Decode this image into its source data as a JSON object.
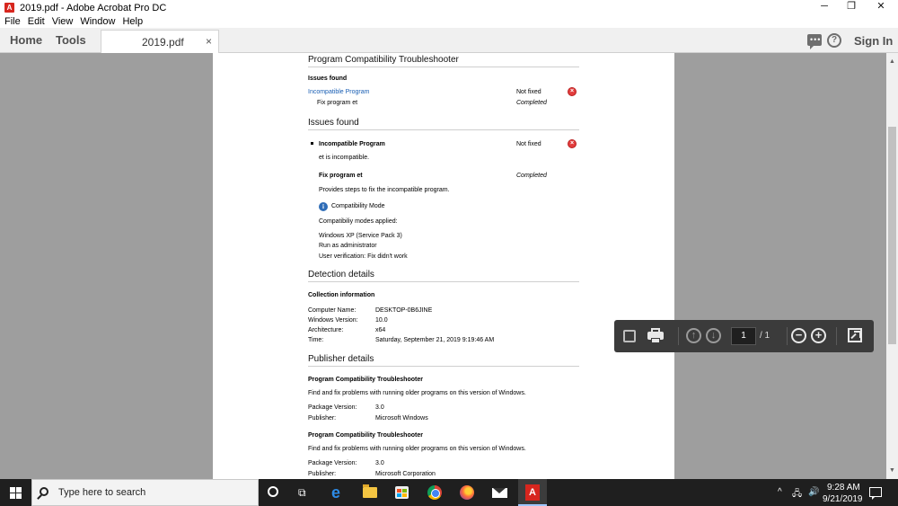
{
  "window": {
    "title": "2019.pdf - Adobe Acrobat Pro DC",
    "app_icon": "acrobat-pdf-icon",
    "minimize": "─",
    "maximize": "❐",
    "close": "✕"
  },
  "menu": [
    "File",
    "Edit",
    "View",
    "Window",
    "Help"
  ],
  "tabs": {
    "home": "Home",
    "tools": "Tools",
    "document": "2019.pdf",
    "document_close": "×",
    "sign_in": "Sign In",
    "help_glyph": "?"
  },
  "document": {
    "section1_title": "Program Compatibility Troubleshooter",
    "issues_found_small": "Issues found",
    "issue_link": "Incompatible Program",
    "issue_status": "Not fixed",
    "fix_label": "Fix program et",
    "fix_status": "Completed",
    "section2_title": "Issues found",
    "issue_bold": "Incompatible Program",
    "issue_bold_status": "Not fixed",
    "issue_desc": "et is incompatible.",
    "fix_bold": "Fix program et",
    "fix_bold_status": "Completed",
    "fix_desc": "Provides steps to fix the incompatible program.",
    "compat_mode": "Compatibility Mode",
    "compat_applied": "Compatibiliy modes applied:",
    "mode_1": "Windows XP (Service Pack 3)",
    "mode_2": "Run as administrator",
    "mode_3": "User verification: Fix didn't work",
    "detection_title": "Detection details",
    "collection_title": "Collection information",
    "computer_name_label": "Computer Name:",
    "computer_name": "DESKTOP-0B6JINE",
    "windows_version_label": "Windows Version:",
    "windows_version": "10.0",
    "architecture_label": "Architecture:",
    "architecture": "x64",
    "time_label": "Time:",
    "time": "Saturday, September 21, 2019 9:19:46 AM",
    "publisher_title": "Publisher details",
    "pub1_title": "Program Compatibility Troubleshooter",
    "pub1_desc": "Find and fix problems with running older programs on this version of Windows.",
    "pub1_pkg_label": "Package Version:",
    "pub1_pkg": "3.0",
    "pub1_publisher_label": "Publisher:",
    "pub1_publisher": "Microsoft Windows",
    "pub2_title": "Program Compatibility Troubleshooter",
    "pub2_desc": "Find and fix problems with running older programs on this version of Windows.",
    "pub2_pkg_label": "Package Version:",
    "pub2_pkg": "3.0",
    "pub2_publisher_label": "Publisher:",
    "pub2_publisher": "Microsoft Corporation"
  },
  "page_toolbar": {
    "current_page": "1",
    "page_total": "/ 1",
    "zoom_out": "−",
    "zoom_in": "+",
    "prev": "↑",
    "next": "↓"
  },
  "taskbar": {
    "search_placeholder": "Type here to search",
    "time": "9:28 AM",
    "date": "9/21/2019",
    "tray_chevron": "^"
  }
}
